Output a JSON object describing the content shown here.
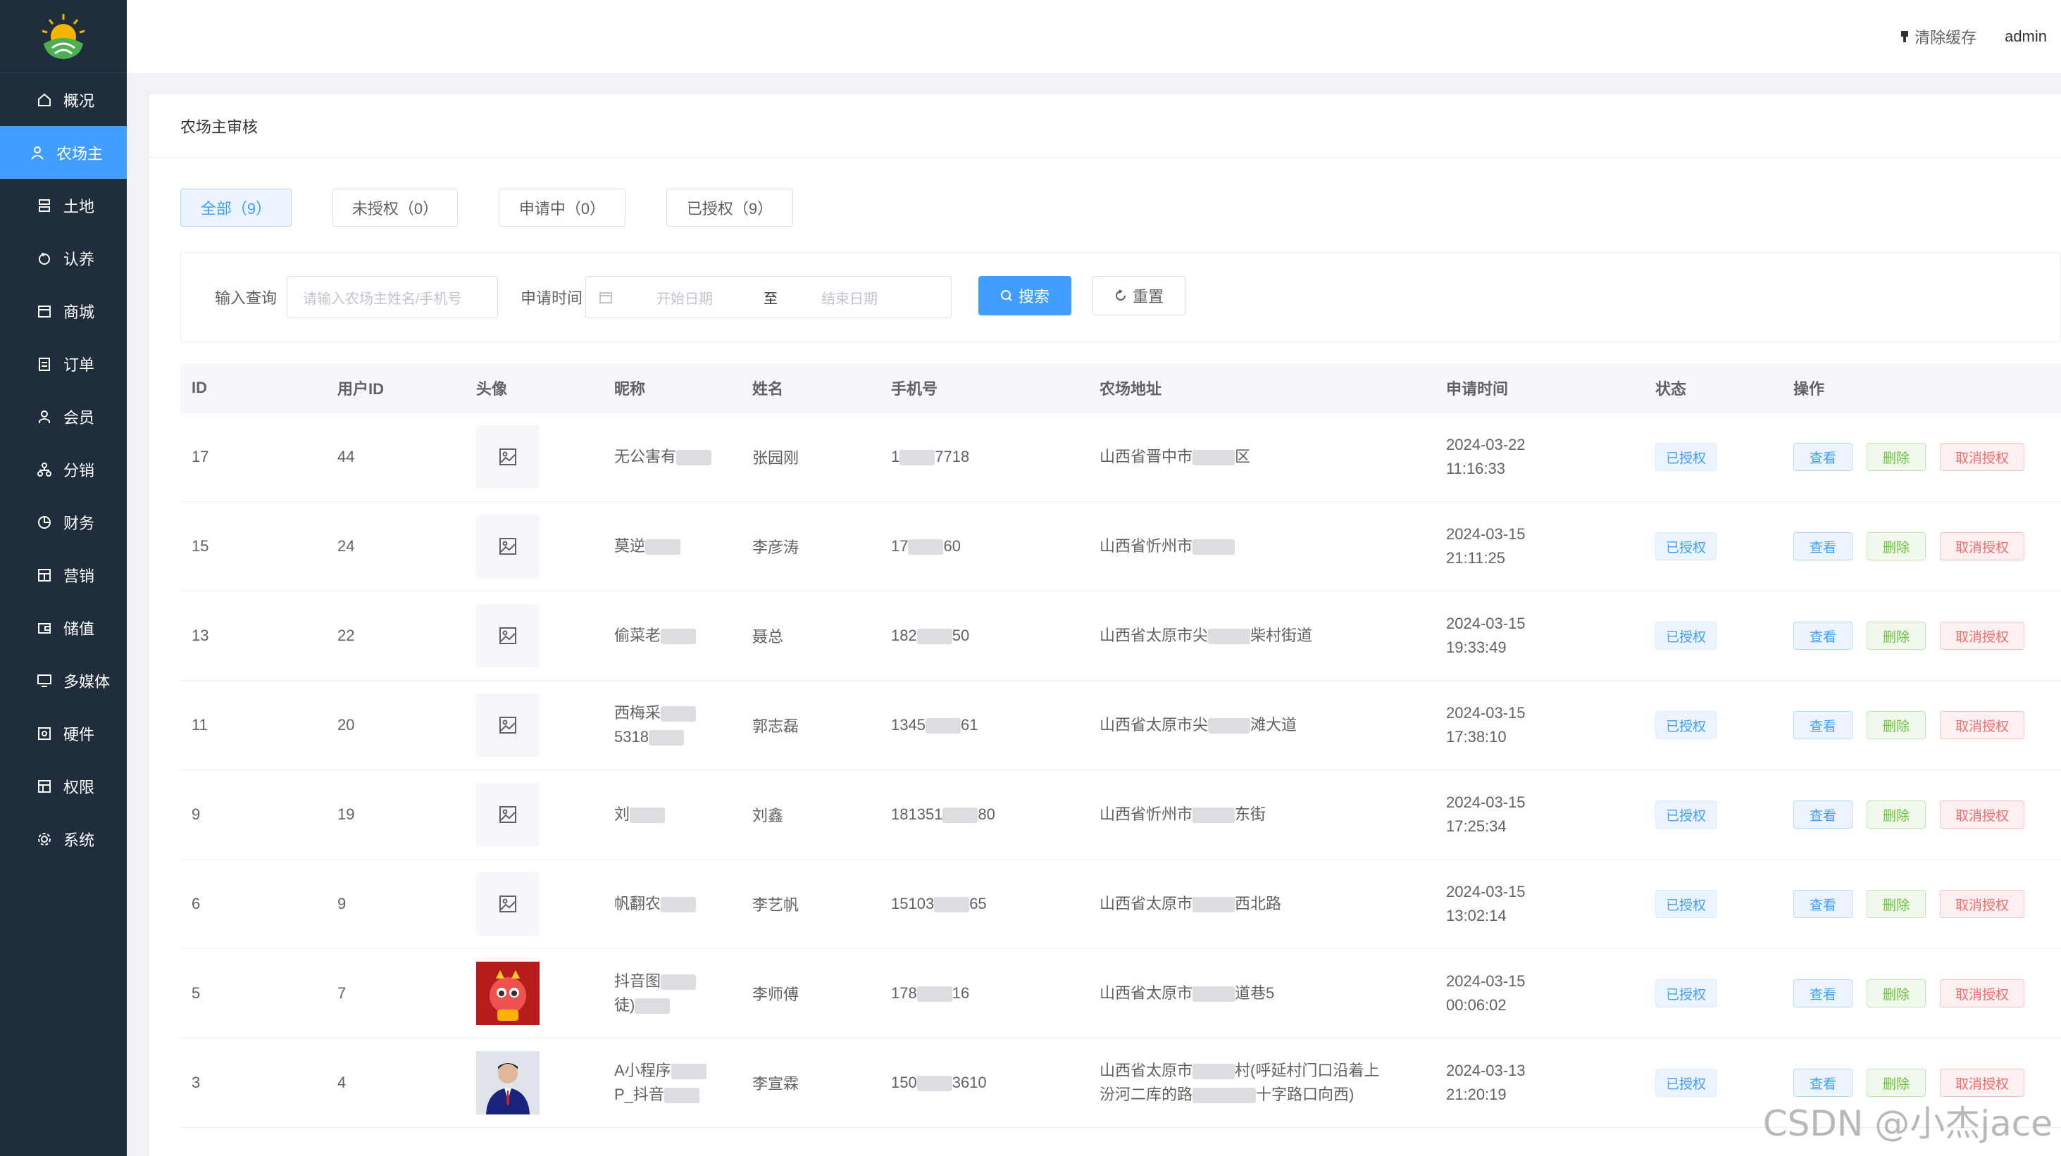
{
  "sidebar": {
    "items": [
      {
        "label": "概况",
        "icon": "home-icon"
      },
      {
        "label": "农场主",
        "icon": "user-icon",
        "active": true
      },
      {
        "label": "土地",
        "icon": "land-icon"
      },
      {
        "label": "认养",
        "icon": "refresh-icon"
      },
      {
        "label": "商城",
        "icon": "shop-icon"
      },
      {
        "label": "订单",
        "icon": "order-icon"
      },
      {
        "label": "会员",
        "icon": "member-icon"
      },
      {
        "label": "分销",
        "icon": "share-icon"
      },
      {
        "label": "财务",
        "icon": "finance-icon"
      },
      {
        "label": "营销",
        "icon": "marketing-icon"
      },
      {
        "label": "储值",
        "icon": "wallet-icon"
      },
      {
        "label": "多媒体",
        "icon": "media-icon"
      },
      {
        "label": "硬件",
        "icon": "hardware-icon"
      },
      {
        "label": "权限",
        "icon": "permission-icon"
      },
      {
        "label": "系统",
        "icon": "gear-icon"
      }
    ]
  },
  "header": {
    "clear_cache": "清除缓存",
    "user": "admin"
  },
  "page": {
    "title": "农场主审核"
  },
  "tabs": [
    {
      "label": "全部（9）",
      "active": true
    },
    {
      "label": "未授权（0）"
    },
    {
      "label": "申请中（0）"
    },
    {
      "label": "已授权（9）"
    }
  ],
  "filter": {
    "query_label": "输入查询",
    "query_placeholder": "请输入农场主姓名/手机号",
    "date_label": "申请时间",
    "start_placeholder": "开始日期",
    "range_sep": "至",
    "end_placeholder": "结束日期",
    "search_label": "搜索",
    "reset_label": "重置"
  },
  "table": {
    "headers": [
      "ID",
      "用户ID",
      "头像",
      "昵称",
      "姓名",
      "手机号",
      "农场地址",
      "申请时间",
      "状态",
      "操作"
    ],
    "rows": [
      {
        "id": "17",
        "uid": "44",
        "avatar": "placeholder",
        "nick1": "无公害有",
        "nick2": "",
        "name": "张园刚",
        "phone_a": "1",
        "phone_b": "7718",
        "addr1": "山西省晋中市",
        "addr2": "区",
        "addr3": "",
        "date": "2024-03-22",
        "time": "11:16:33",
        "status": "已授权"
      },
      {
        "id": "15",
        "uid": "24",
        "avatar": "placeholder",
        "nick1": "莫逆",
        "nick2": "",
        "name": "李彦涛",
        "phone_a": "17",
        "phone_b": "60",
        "addr1": "山西省忻州市",
        "addr2": "",
        "addr3": "",
        "date": "2024-03-15",
        "time": "21:11:25",
        "status": "已授权"
      },
      {
        "id": "13",
        "uid": "22",
        "avatar": "placeholder",
        "nick1": "偷菜老",
        "nick2": "",
        "name": "聂总",
        "phone_a": "182",
        "phone_b": "50",
        "addr1": "山西省太原市尖",
        "addr2": "柴村街道",
        "addr3": "",
        "date": "2024-03-15",
        "time": "19:33:49",
        "status": "已授权"
      },
      {
        "id": "11",
        "uid": "20",
        "avatar": "placeholder",
        "nick1": "西梅采",
        "nick2": "5318",
        "name": "郭志磊",
        "phone_a": "1345",
        "phone_b": "61",
        "addr1": "山西省太原市尖",
        "addr2": "滩大道",
        "addr3": "",
        "date": "2024-03-15",
        "time": "17:38:10",
        "status": "已授权"
      },
      {
        "id": "9",
        "uid": "19",
        "avatar": "placeholder",
        "nick1": "刘",
        "nick2": "",
        "name": "刘鑫",
        "phone_a": "181351",
        "phone_b": "80",
        "addr1": "山西省忻州市",
        "addr2": "东街",
        "addr3": "",
        "date": "2024-03-15",
        "time": "17:25:34",
        "status": "已授权"
      },
      {
        "id": "6",
        "uid": "9",
        "avatar": "placeholder",
        "nick1": "帆翻农",
        "nick2": "",
        "name": "李艺帆",
        "phone_a": "15103",
        "phone_b": "65",
        "addr1": "山西省太原市",
        "addr2": "西北路",
        "addr3": "",
        "date": "2024-03-15",
        "time": "13:02:14",
        "status": "已授权"
      },
      {
        "id": "5",
        "uid": "7",
        "avatar": "dragon",
        "nick1": "抖音图",
        "nick2": "徒)",
        "name": "李师傅",
        "phone_a": "178",
        "phone_b": "16",
        "addr1": "山西省太原市",
        "addr2": "道巷5",
        "addr3": "",
        "date": "2024-03-15",
        "time": "00:06:02",
        "status": "已授权"
      },
      {
        "id": "3",
        "uid": "4",
        "avatar": "person",
        "nick1": "A小程序",
        "nick2": "P_抖音",
        "name": "李宣霖",
        "phone_a": "150",
        "phone_b": "3610",
        "addr1": "山西省太原市",
        "addr2": "村(呼延村门口沿着上",
        "addr3": "汾河二库的路",
        "addr4": "十字路口向西)",
        "date": "2024-03-13",
        "time": "21:20:19",
        "status": "已授权"
      }
    ],
    "ops": {
      "view": "查看",
      "delete": "删除",
      "cancel": "取消授权"
    }
  },
  "watermark": "CSDN @小杰jace",
  "colors": {
    "sidebar": "#1f2d3d",
    "primary": "#409eff",
    "success": "#67c23a",
    "danger": "#f56c6c"
  }
}
